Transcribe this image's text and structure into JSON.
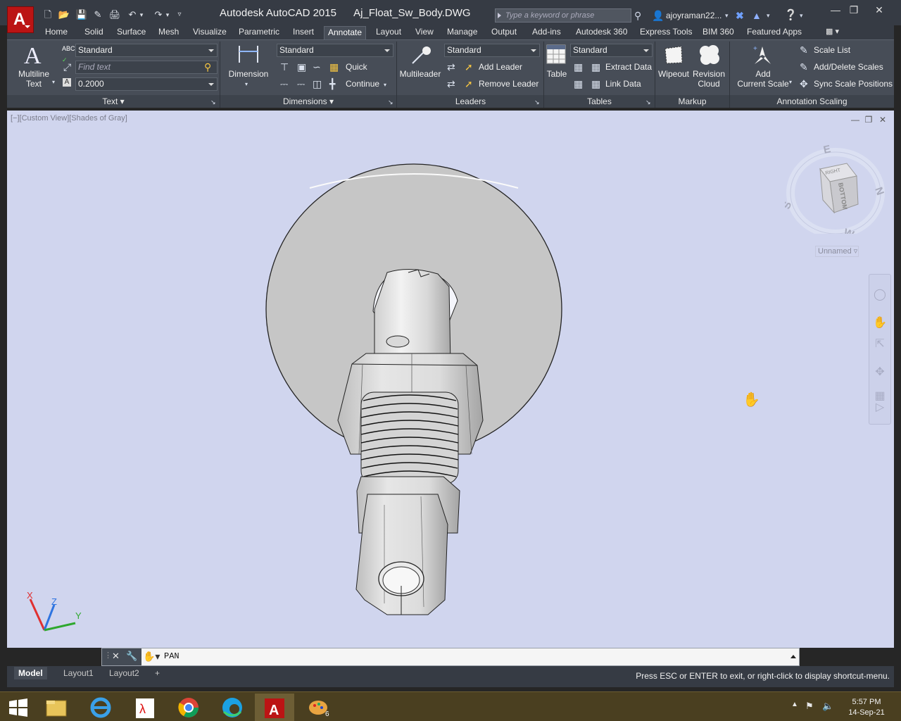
{
  "titlebar": {
    "app_name": "Autodesk AutoCAD 2015",
    "file_name": "Aj_Float_Sw_Body.DWG",
    "search_placeholder": "Type a keyword or phrase",
    "user_name": "ajoyraman22...",
    "logo_letter": "A"
  },
  "ribbon_tabs": [
    "Home",
    "Solid",
    "Surface",
    "Mesh",
    "Visualize",
    "Parametric",
    "Insert",
    "Annotate",
    "Layout",
    "View",
    "Manage",
    "Output",
    "Add-ins",
    "Autodesk 360",
    "Express Tools",
    "BIM 360",
    "Featured Apps"
  ],
  "active_tab": "Annotate",
  "text_panel": {
    "title": "Text",
    "multiline_label_1": "Multiline",
    "multiline_label_2": "Text",
    "style": "Standard",
    "find_placeholder": "Find text",
    "height": "0.2000"
  },
  "dimensions_panel": {
    "title": "Dimensions",
    "dimension_label": "Dimension",
    "style": "Standard",
    "quick_label": "Quick",
    "continue_label": "Continue"
  },
  "leaders_panel": {
    "title": "Leaders",
    "multileader_label": "Multileader",
    "style": "Standard",
    "add_leader_label": "Add Leader",
    "remove_leader_label": "Remove Leader"
  },
  "tables_panel": {
    "title": "Tables",
    "table_label": "Table",
    "style": "Standard",
    "extract_data_label": "Extract Data",
    "link_data_label": "Link Data"
  },
  "markup_panel": {
    "title": "Markup",
    "wipeout_label": "Wipeout",
    "revision_label_1": "Revision",
    "revision_label_2": "Cloud"
  },
  "annotation_scaling_panel": {
    "title": "Annotation Scaling",
    "add_label_1": "Add",
    "add_label_2": "Current Scale",
    "scale_list_label": "Scale List",
    "add_delete_label": "Add/Delete Scales",
    "sync_label": "Sync Scale Positions"
  },
  "viewport": {
    "label": "[−][Custom View][Shades of Gray]",
    "viewcube_top": "RIGHT",
    "viewcube_face": "BOTTOM",
    "compass": {
      "n": "N",
      "s": "S",
      "e": "E",
      "w": "W"
    },
    "viewcube_menu": "Unnamed",
    "ucs": {
      "x": "X",
      "y": "Y",
      "z": "Z"
    }
  },
  "command_line": {
    "command": "PAN"
  },
  "status_bar": {
    "tabs": [
      "Model",
      "Layout1",
      "Layout2"
    ],
    "active_tab": "Model",
    "message": "Press ESC or ENTER to exit, or right-click to display shortcut-menu."
  },
  "taskbar": {
    "time": "5:57 PM",
    "date": "14-Sep-21",
    "badge_count": "6"
  },
  "colors": {
    "viewport_background": "#d0d5ee",
    "ribbon": "#474d57",
    "titlebar": "#363b44",
    "taskbar": "#4a3f20",
    "logo": "#bb1414"
  }
}
